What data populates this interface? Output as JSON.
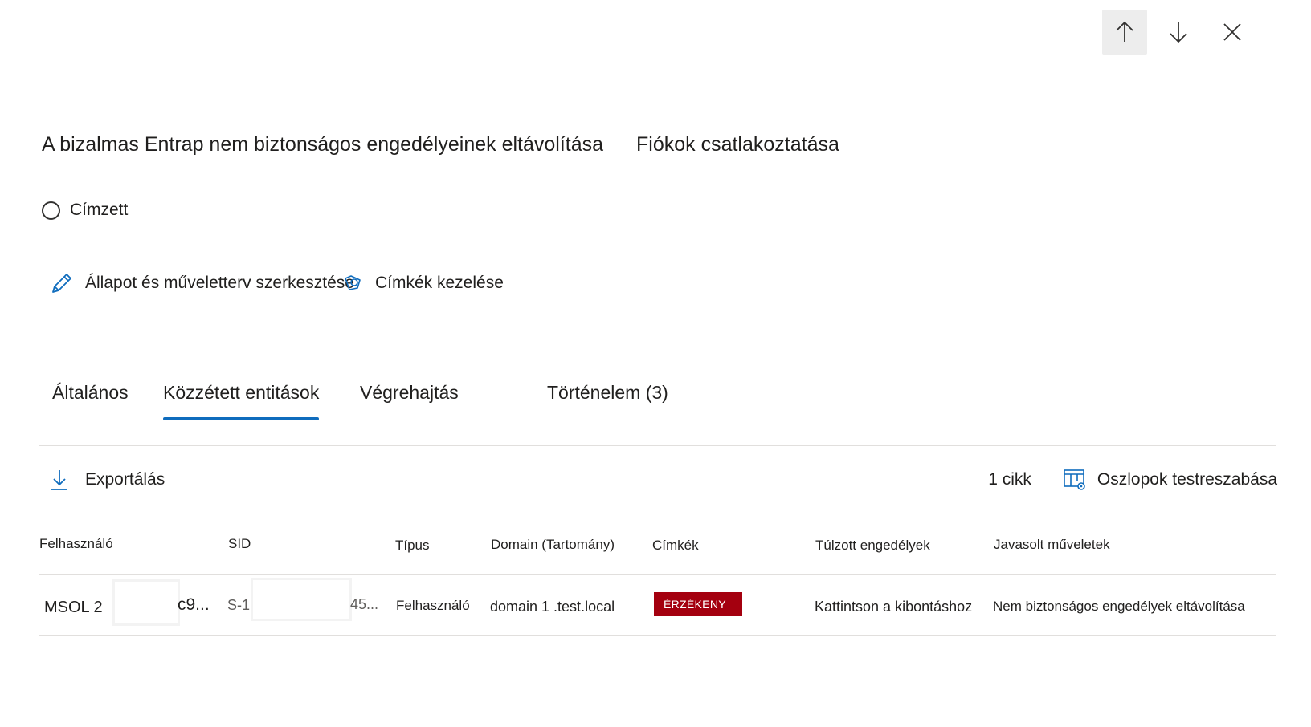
{
  "nav": {
    "up_icon": "arrow-up-icon",
    "down_icon": "arrow-down-icon",
    "close_icon": "close-icon"
  },
  "header": {
    "title": "A bizalmas Entrap nem biztonságos engedélyeinek eltávolítása",
    "subtitle": "Fiókok csatlakoztatása"
  },
  "status": {
    "label": "Címzett"
  },
  "actions": {
    "edit_label": "Állapot és műveletterv szerkesztése",
    "tags_label": "Címkék kezelése"
  },
  "tabs": [
    {
      "label": "Általános"
    },
    {
      "label": "Közzétett entitások"
    },
    {
      "label": "Végrehajtás"
    },
    {
      "label": "Történelem (3)"
    }
  ],
  "toolbar": {
    "export_label": "Exportálás",
    "count_label": "1 cikk",
    "customize_label": "Oszlopok testreszabása"
  },
  "table": {
    "columns": [
      "Felhasználó",
      "SID",
      "Típus",
      "Domain (Tartomány)",
      "Címkék",
      "Túlzott engedélyek",
      "Javasolt műveletek"
    ],
    "rows": [
      {
        "user_prefix": "MSOL 2",
        "user_suffix": "c9...",
        "sid_prefix": "S-1",
        "sid_suffix": "45...",
        "type": "Felhasználó",
        "domain": "domain 1 .test.local",
        "tag": "ÉRZÉKENY",
        "permissions": "Kattintson a kibontáshoz",
        "action": "Nem biztonságos engedélyek eltávolítása"
      }
    ]
  },
  "colors": {
    "accent": "#0f6cbd",
    "badge": "#a4000f"
  }
}
